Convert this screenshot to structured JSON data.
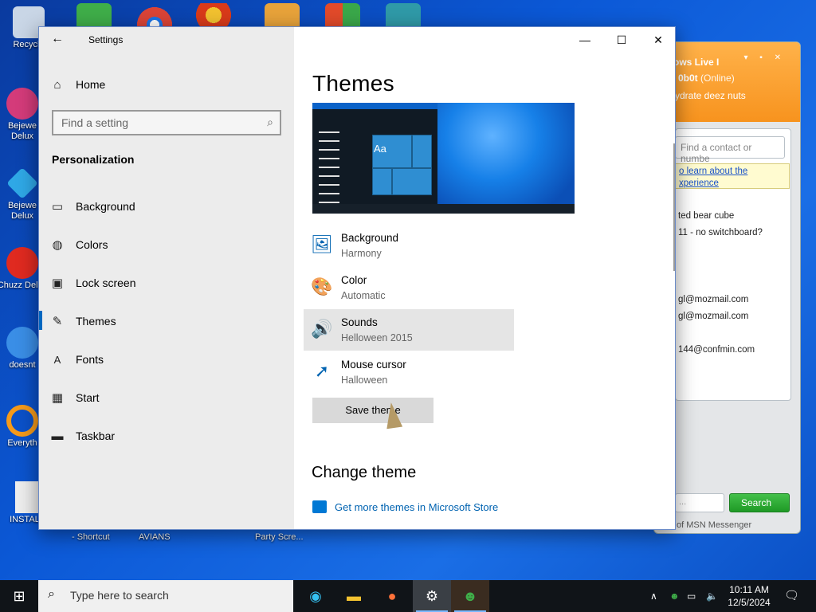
{
  "desktop": {
    "left_icons": [
      {
        "name": "recycle-bin",
        "label": "Recycle",
        "color": "#c9d6e6"
      },
      {
        "name": "bejeweled-2",
        "label": "Bejewe Delux",
        "color": "#d43b7a"
      },
      {
        "name": "bejeweled",
        "label": "Bejewe Delux",
        "color": "#2fa8e6"
      },
      {
        "name": "chuzzle",
        "label": "Chuzz Delux",
        "color": "#e02a20"
      },
      {
        "name": "doesnt",
        "label": "doesnt",
        "color": "#3a8ee6"
      },
      {
        "name": "everything",
        "label": "Everyth",
        "color": "#f59a1a"
      },
      {
        "name": "install",
        "label": "INSTALL",
        "color": "#eeeeee"
      }
    ],
    "bottom_labels": [
      "- Shortcut",
      "AVIANS",
      "Party Scre..."
    ]
  },
  "msn": {
    "title": "ows Live I",
    "user": "0b0t",
    "status": "(Online)",
    "message": "ydrate deez nuts",
    "find_placeholder": "Find a contact or numbe",
    "tip_text": "o learn about the xperience",
    "lines": [
      "ted bear cube",
      "11 - no switchboard?",
      "gl@mozmail.com",
      "gl@mozmail.com",
      "144@confmin.com"
    ],
    "search_label": "Search",
    "footer": "of MSN Messenger"
  },
  "settings": {
    "window_title": "Settings",
    "home_label": "Home",
    "search_placeholder": "Find a setting",
    "section_title": "Personalization",
    "nav_items": [
      {
        "label": "Background",
        "icon": "picture-icon"
      },
      {
        "label": "Colors",
        "icon": "palette-icon"
      },
      {
        "label": "Lock screen",
        "icon": "lock-screen-icon"
      },
      {
        "label": "Themes",
        "icon": "brush-icon"
      },
      {
        "label": "Fonts",
        "icon": "fonts-icon"
      },
      {
        "label": "Start",
        "icon": "start-icon"
      },
      {
        "label": "Taskbar",
        "icon": "taskbar-icon"
      }
    ],
    "selected_nav": "Themes",
    "page_title": "Themes",
    "preview_text": "Aa",
    "options": [
      {
        "name": "Background",
        "value": "Harmony",
        "icon": "picture-icon"
      },
      {
        "name": "Color",
        "value": "Automatic",
        "icon": "palette-icon"
      },
      {
        "name": "Sounds",
        "value": "Helloween 2015",
        "icon": "speaker-icon"
      },
      {
        "name": "Mouse cursor",
        "value": "Halloween",
        "icon": "cursor-icon"
      }
    ],
    "save_label": "Save theme",
    "change_theme_title": "Change theme",
    "store_link": "Get more themes in Microsoft Store"
  },
  "taskbar": {
    "search_placeholder": "Type here to search",
    "apps": [
      "edge",
      "file-explorer",
      "firefox",
      "settings",
      "msn-messenger"
    ],
    "active_app": "settings",
    "time": "10:11 AM",
    "date": "12/5/2024"
  }
}
